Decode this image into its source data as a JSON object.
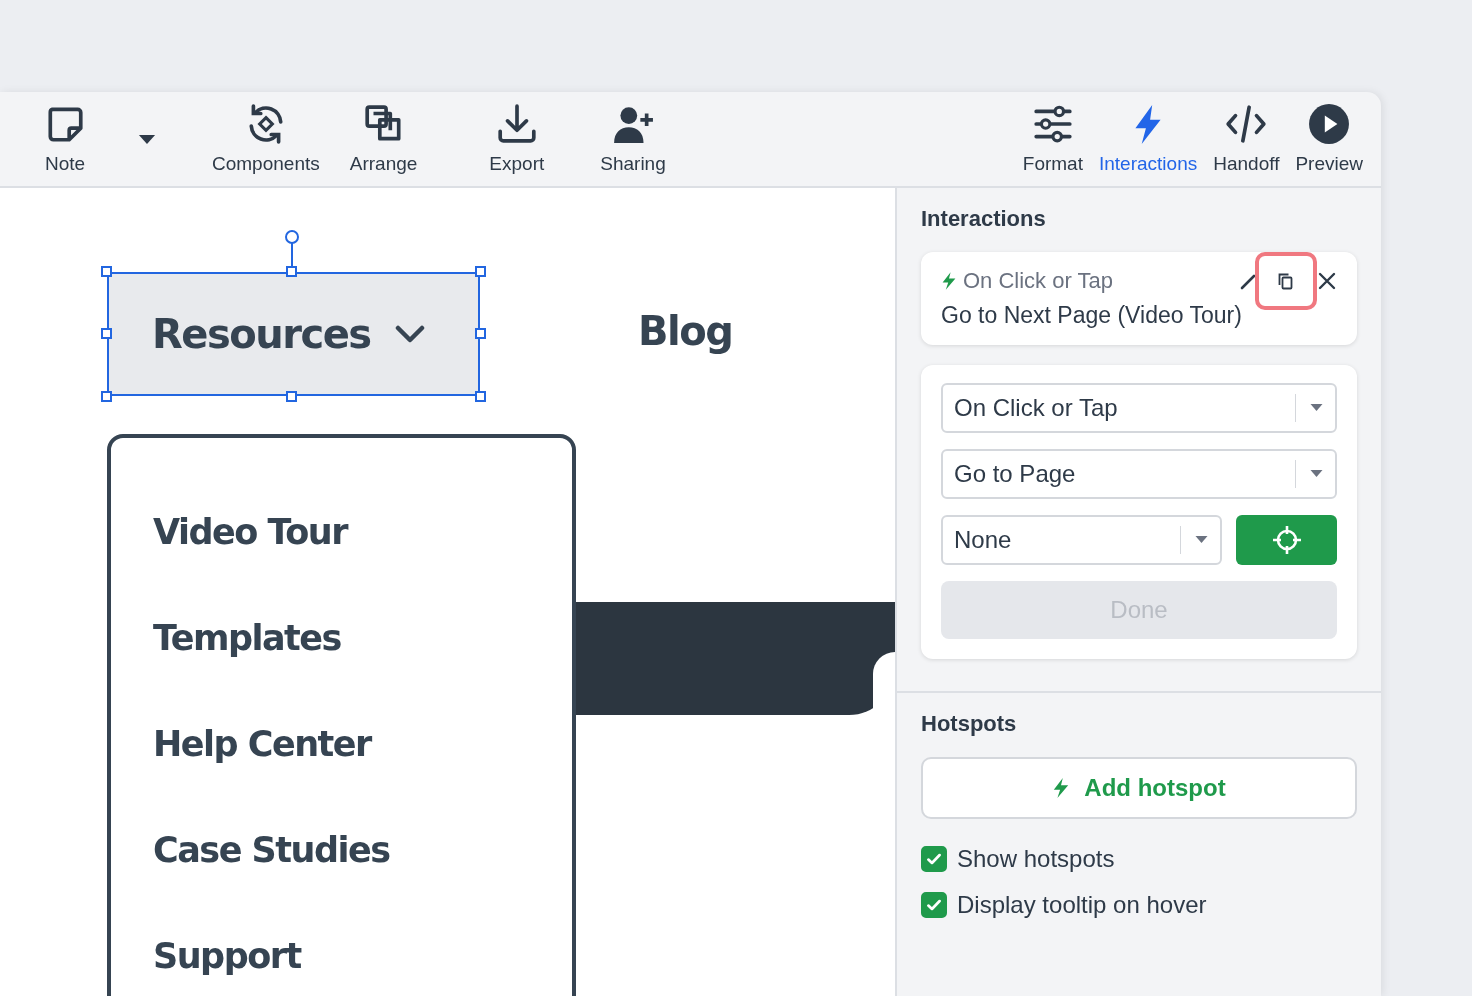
{
  "toolbar": {
    "left": [
      {
        "label": "Note",
        "selected": false
      },
      {
        "label": "Components",
        "selected": false
      },
      {
        "label": "Arrange",
        "selected": false
      },
      {
        "label": "Export",
        "selected": false
      },
      {
        "label": "Sharing",
        "selected": false
      }
    ],
    "right": [
      {
        "label": "Format",
        "selected": false
      },
      {
        "label": "Interactions",
        "selected": true
      },
      {
        "label": "Handoff",
        "selected": false
      },
      {
        "label": "Preview",
        "selected": false
      }
    ]
  },
  "canvas": {
    "nav": [
      {
        "label": "Resources",
        "selected": true
      },
      {
        "label": "Blog",
        "selected": false
      }
    ],
    "menu": [
      "Video Tour",
      "Templates",
      "Help Center",
      "Case Studies",
      "Support"
    ]
  },
  "panel": {
    "title": "Interactions",
    "interaction": {
      "trigger": "On Click or Tap",
      "action": "Go to Next Page (Video Tour)",
      "copy_highlighted": true
    },
    "editor": {
      "selects": [
        "On Click or Tap",
        "Go to Page"
      ],
      "target": "None",
      "done": {
        "label": "Done",
        "disabled": true
      }
    },
    "hotspots": {
      "title": "Hotspots",
      "add_label": "Add hotspot",
      "options": [
        {
          "label": "Show hotspots",
          "checked": true
        },
        {
          "label": "Display tooltip on hover",
          "checked": true
        }
      ]
    }
  }
}
